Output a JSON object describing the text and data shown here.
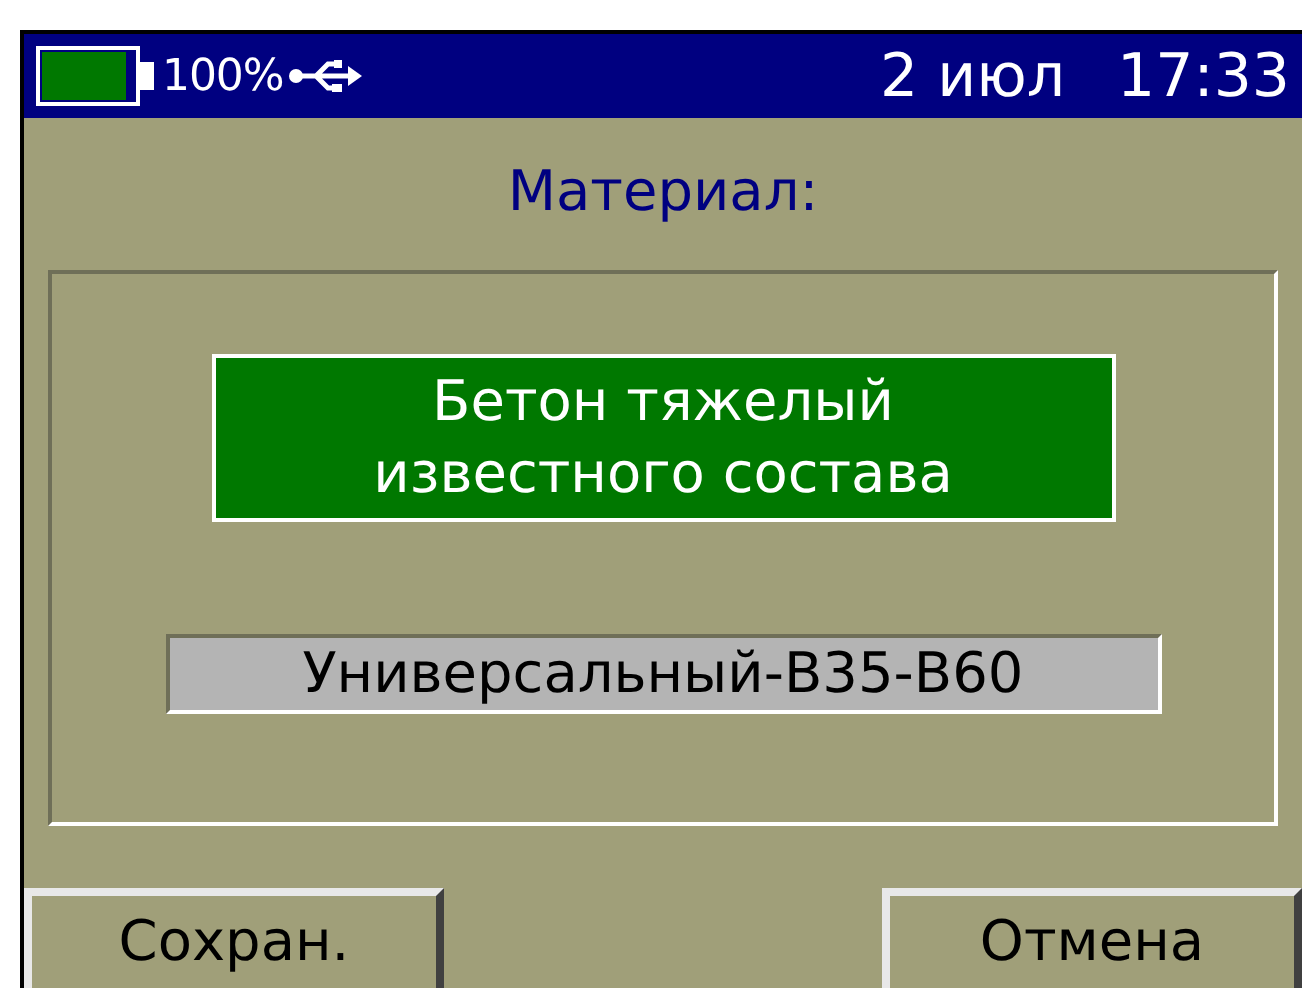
{
  "status_bar": {
    "battery": {
      "level": 1.0
    },
    "battery_text": "100%",
    "date": "2 июл",
    "time": "17:33"
  },
  "title": "Материал:",
  "options": [
    {
      "lines": [
        "Бетон тяжелый",
        "известного состава"
      ],
      "selected": true
    },
    {
      "lines": [
        "Универсальный-В35-В60"
      ],
      "selected": false
    }
  ],
  "buttons": [
    "Сохран.",
    "Отмена"
  ]
}
